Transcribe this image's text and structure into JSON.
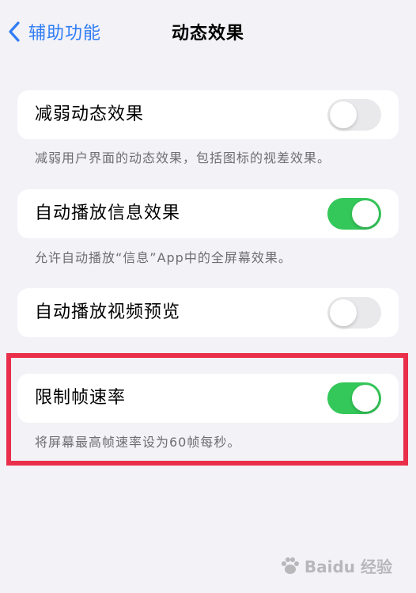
{
  "nav": {
    "back_label": "辅助功能",
    "title": "动态效果"
  },
  "settings": [
    {
      "label": "减弱动态效果",
      "on": false,
      "footnote": "减弱用户界面的动态效果，包括图标的视差效果。"
    },
    {
      "label": "自动播放信息效果",
      "on": true,
      "footnote": "允许自动播放“信息”App中的全屏幕效果。"
    },
    {
      "label": "自动播放视频预览",
      "on": false,
      "footnote": ""
    },
    {
      "label": "限制帧速率",
      "on": true,
      "footnote": "将屏幕最高帧速率设为60帧每秒。"
    }
  ],
  "colors": {
    "accent": "#2f7cf6",
    "toggle_on": "#34c759",
    "toggle_off": "#e9e9eb",
    "highlight": "#ea2f4b"
  },
  "watermark": {
    "text": "Baidu 经验",
    "icon": "paw-icon"
  }
}
